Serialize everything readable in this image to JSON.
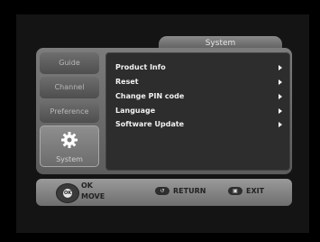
{
  "title": "System",
  "side_tabs": [
    {
      "label": "Guide"
    },
    {
      "label": "Channel"
    },
    {
      "label": "Preference"
    },
    {
      "label": "System",
      "icon": "gear-icon",
      "active": true
    }
  ],
  "menu": [
    {
      "label": "Product Info"
    },
    {
      "label": "Reset"
    },
    {
      "label": "Change PIN code"
    },
    {
      "label": "Language"
    },
    {
      "label": "Software Update"
    }
  ],
  "help": {
    "ok_label": "OK",
    "move_label": "MOVE",
    "return_label": "RETURN",
    "exit_label": "EXIT",
    "dpad_text": "OK"
  }
}
